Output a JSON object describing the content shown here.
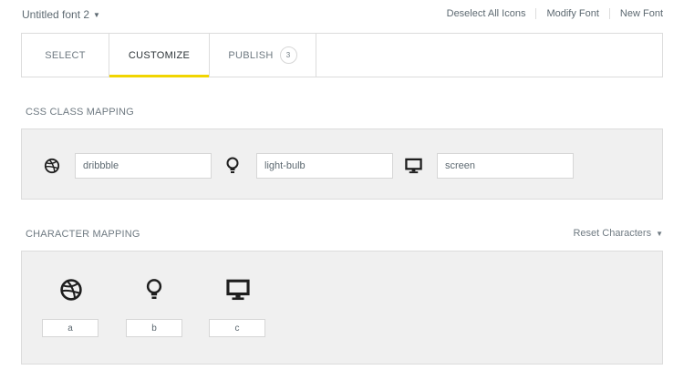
{
  "topbar": {
    "font_name": "Untitled font 2",
    "actions": [
      "Deselect All Icons",
      "Modify Font",
      "New Font"
    ]
  },
  "tabs": [
    {
      "label": "SELECT"
    },
    {
      "label": "CUSTOMIZE",
      "active": true
    },
    {
      "label": "PUBLISH",
      "count": "3"
    }
  ],
  "accent_color": "#f1d500",
  "css_mapping": {
    "title": "CSS CLASS MAPPING",
    "items": [
      {
        "icon": "dribbble-icon",
        "value": "dribbble"
      },
      {
        "icon": "light-bulb-icon",
        "value": "light-bulb"
      },
      {
        "icon": "screen-icon",
        "value": "screen"
      }
    ]
  },
  "char_mapping": {
    "title": "CHARACTER MAPPING",
    "reset_label": "Reset Characters",
    "items": [
      {
        "icon": "dribbble-icon",
        "char": "a"
      },
      {
        "icon": "light-bulb-icon",
        "char": "b"
      },
      {
        "icon": "screen-icon",
        "char": "c"
      }
    ]
  }
}
